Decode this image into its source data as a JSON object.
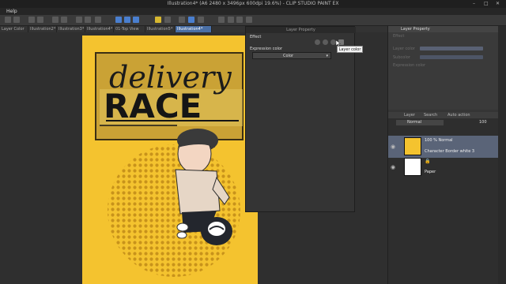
{
  "window": {
    "title": "Illustration4* (A6 2480 x 3496px 600dpi 19.6%) - CLIP STUDIO PAINT EX"
  },
  "menu": {
    "help": "Help"
  },
  "tabs": [
    {
      "label": "Layer Color"
    },
    {
      "label": "Illustration2*"
    },
    {
      "label": "Illustration3*"
    },
    {
      "label": "Illustration4*"
    },
    {
      "label": "01-Top View (..."
    },
    {
      "label": "Illustration5*"
    },
    {
      "label": "Illustration4*"
    }
  ],
  "effect_panel": {
    "title": "Layer Property",
    "effect_label": "Effect",
    "expression_color_label": "Expression color",
    "expression_color_value": "Color"
  },
  "tooltip": {
    "text": "Layer color"
  },
  "layer_property_top": {
    "title": "Layer Property",
    "effect": "Effect",
    "row1": "Layer color",
    "row2": "Subcolor",
    "row3": "Expression color"
  },
  "layer_panel": {
    "tabs": [
      "Layer",
      "Search",
      "Auto action"
    ],
    "blend_mode": "Normal",
    "opacity": "100",
    "layers": [
      {
        "line1": "100 % Normal",
        "line2": "Character Border white 3"
      },
      {
        "line1": "",
        "line2": "Paper"
      }
    ]
  },
  "artwork": {
    "title_line1": "delivery",
    "title_line2": "RACE",
    "background_color": "#f4c32f"
  },
  "colors": {
    "accent": "#4a6fa5",
    "panel": "#343434",
    "selected_layer": "#5a6478"
  }
}
